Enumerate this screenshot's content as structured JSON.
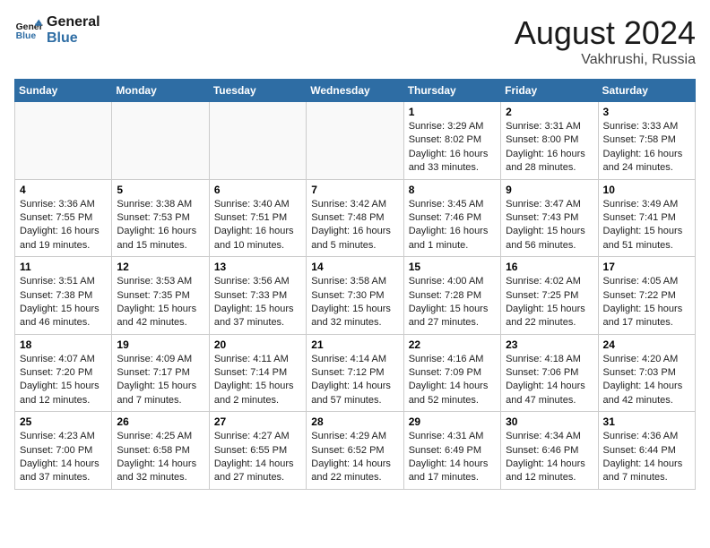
{
  "header": {
    "logo_line1": "General",
    "logo_line2": "Blue",
    "month_year": "August 2024",
    "location": "Vakhrushi, Russia"
  },
  "weekdays": [
    "Sunday",
    "Monday",
    "Tuesday",
    "Wednesday",
    "Thursday",
    "Friday",
    "Saturday"
  ],
  "weeks": [
    [
      {
        "day": "",
        "info": ""
      },
      {
        "day": "",
        "info": ""
      },
      {
        "day": "",
        "info": ""
      },
      {
        "day": "",
        "info": ""
      },
      {
        "day": "1",
        "sunrise": "3:29 AM",
        "sunset": "8:02 PM",
        "daylight": "16 hours and 33 minutes."
      },
      {
        "day": "2",
        "sunrise": "3:31 AM",
        "sunset": "8:00 PM",
        "daylight": "16 hours and 28 minutes."
      },
      {
        "day": "3",
        "sunrise": "3:33 AM",
        "sunset": "7:58 PM",
        "daylight": "16 hours and 24 minutes."
      }
    ],
    [
      {
        "day": "4",
        "sunrise": "3:36 AM",
        "sunset": "7:55 PM",
        "daylight": "16 hours and 19 minutes."
      },
      {
        "day": "5",
        "sunrise": "3:38 AM",
        "sunset": "7:53 PM",
        "daylight": "16 hours and 15 minutes."
      },
      {
        "day": "6",
        "sunrise": "3:40 AM",
        "sunset": "7:51 PM",
        "daylight": "16 hours and 10 minutes."
      },
      {
        "day": "7",
        "sunrise": "3:42 AM",
        "sunset": "7:48 PM",
        "daylight": "16 hours and 5 minutes."
      },
      {
        "day": "8",
        "sunrise": "3:45 AM",
        "sunset": "7:46 PM",
        "daylight": "16 hours and 1 minute."
      },
      {
        "day": "9",
        "sunrise": "3:47 AM",
        "sunset": "7:43 PM",
        "daylight": "15 hours and 56 minutes."
      },
      {
        "day": "10",
        "sunrise": "3:49 AM",
        "sunset": "7:41 PM",
        "daylight": "15 hours and 51 minutes."
      }
    ],
    [
      {
        "day": "11",
        "sunrise": "3:51 AM",
        "sunset": "7:38 PM",
        "daylight": "15 hours and 46 minutes."
      },
      {
        "day": "12",
        "sunrise": "3:53 AM",
        "sunset": "7:35 PM",
        "daylight": "15 hours and 42 minutes."
      },
      {
        "day": "13",
        "sunrise": "3:56 AM",
        "sunset": "7:33 PM",
        "daylight": "15 hours and 37 minutes."
      },
      {
        "day": "14",
        "sunrise": "3:58 AM",
        "sunset": "7:30 PM",
        "daylight": "15 hours and 32 minutes."
      },
      {
        "day": "15",
        "sunrise": "4:00 AM",
        "sunset": "7:28 PM",
        "daylight": "15 hours and 27 minutes."
      },
      {
        "day": "16",
        "sunrise": "4:02 AM",
        "sunset": "7:25 PM",
        "daylight": "15 hours and 22 minutes."
      },
      {
        "day": "17",
        "sunrise": "4:05 AM",
        "sunset": "7:22 PM",
        "daylight": "15 hours and 17 minutes."
      }
    ],
    [
      {
        "day": "18",
        "sunrise": "4:07 AM",
        "sunset": "7:20 PM",
        "daylight": "15 hours and 12 minutes."
      },
      {
        "day": "19",
        "sunrise": "4:09 AM",
        "sunset": "7:17 PM",
        "daylight": "15 hours and 7 minutes."
      },
      {
        "day": "20",
        "sunrise": "4:11 AM",
        "sunset": "7:14 PM",
        "daylight": "15 hours and 2 minutes."
      },
      {
        "day": "21",
        "sunrise": "4:14 AM",
        "sunset": "7:12 PM",
        "daylight": "14 hours and 57 minutes."
      },
      {
        "day": "22",
        "sunrise": "4:16 AM",
        "sunset": "7:09 PM",
        "daylight": "14 hours and 52 minutes."
      },
      {
        "day": "23",
        "sunrise": "4:18 AM",
        "sunset": "7:06 PM",
        "daylight": "14 hours and 47 minutes."
      },
      {
        "day": "24",
        "sunrise": "4:20 AM",
        "sunset": "7:03 PM",
        "daylight": "14 hours and 42 minutes."
      }
    ],
    [
      {
        "day": "25",
        "sunrise": "4:23 AM",
        "sunset": "7:00 PM",
        "daylight": "14 hours and 37 minutes."
      },
      {
        "day": "26",
        "sunrise": "4:25 AM",
        "sunset": "6:58 PM",
        "daylight": "14 hours and 32 minutes."
      },
      {
        "day": "27",
        "sunrise": "4:27 AM",
        "sunset": "6:55 PM",
        "daylight": "14 hours and 27 minutes."
      },
      {
        "day": "28",
        "sunrise": "4:29 AM",
        "sunset": "6:52 PM",
        "daylight": "14 hours and 22 minutes."
      },
      {
        "day": "29",
        "sunrise": "4:31 AM",
        "sunset": "6:49 PM",
        "daylight": "14 hours and 17 minutes."
      },
      {
        "day": "30",
        "sunrise": "4:34 AM",
        "sunset": "6:46 PM",
        "daylight": "14 hours and 12 minutes."
      },
      {
        "day": "31",
        "sunrise": "4:36 AM",
        "sunset": "6:44 PM",
        "daylight": "14 hours and 7 minutes."
      }
    ]
  ]
}
